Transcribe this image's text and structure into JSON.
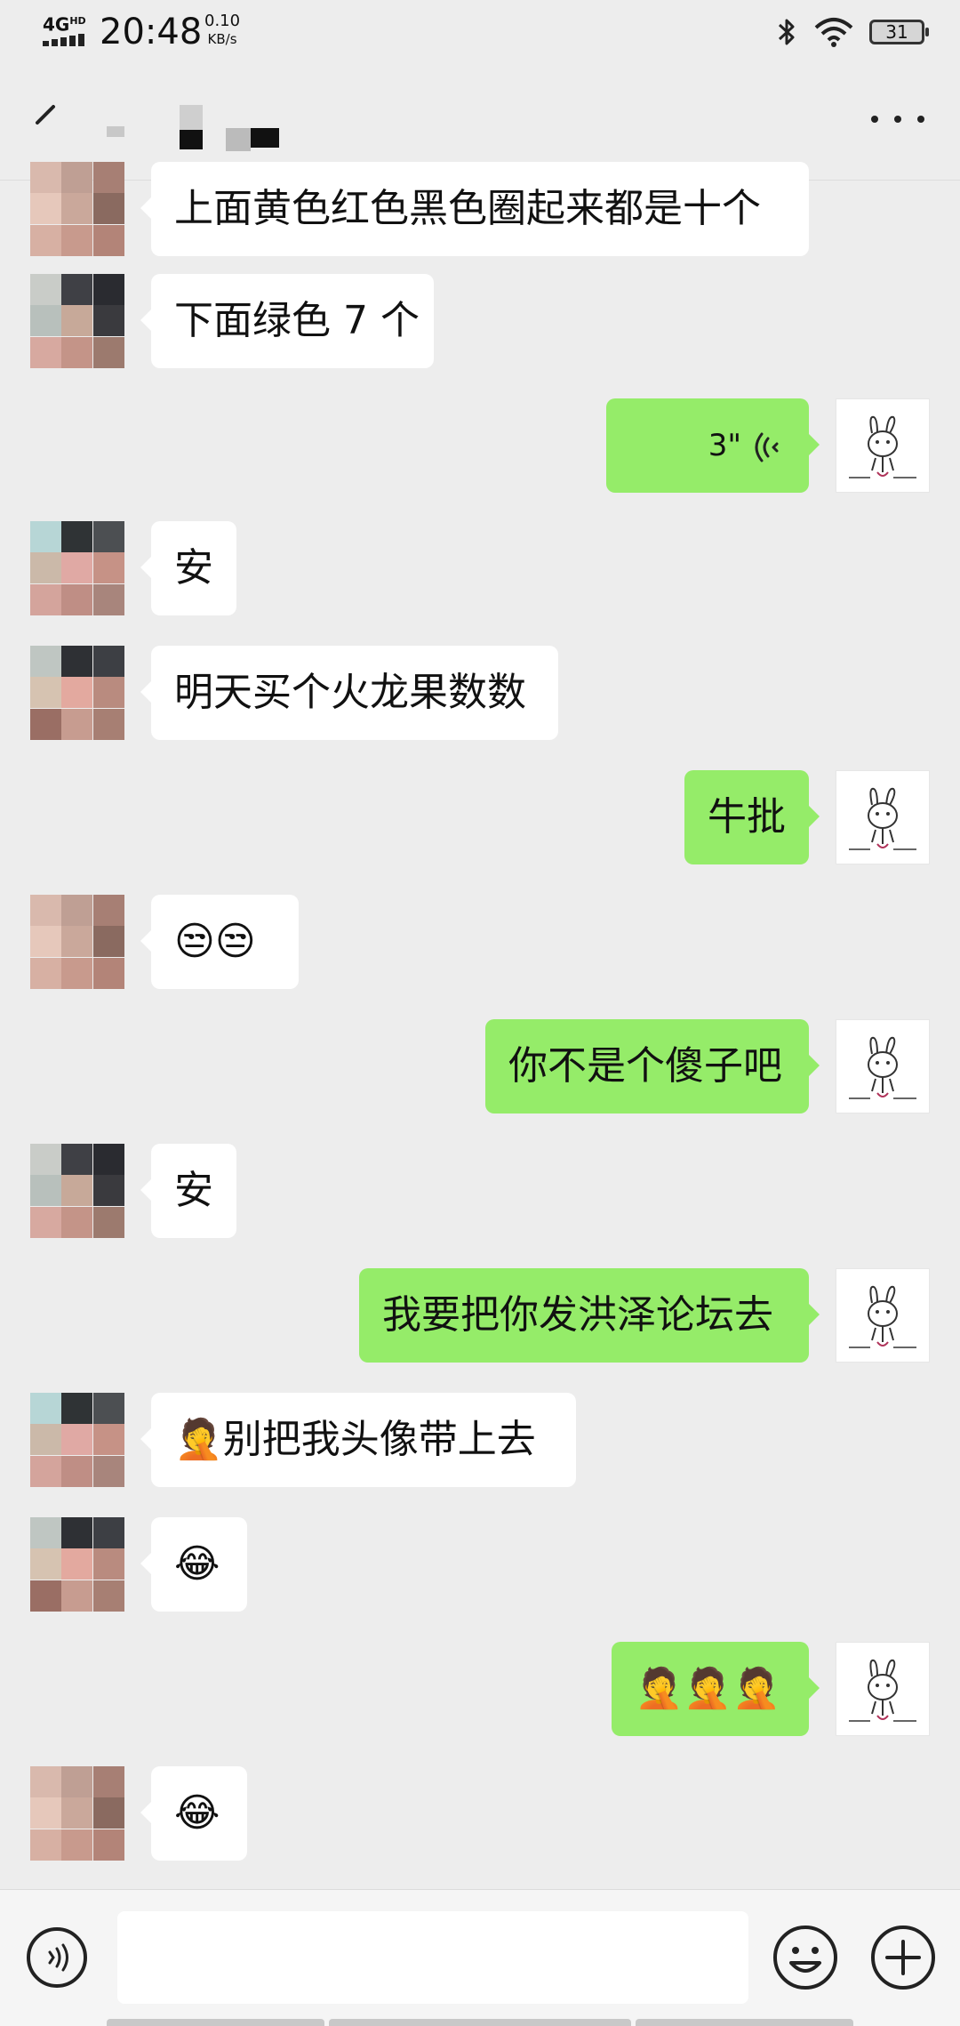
{
  "status_bar": {
    "network": "4G",
    "network_sup": "HD",
    "time": "20:48",
    "speed_value": "0.10",
    "speed_unit": "KB/s",
    "battery": "31"
  },
  "header": {
    "title": "",
    "more_icon": "ellipsis-icon",
    "back_icon": "back-arrow-icon"
  },
  "messages": [
    {
      "side": "left",
      "text": "上面黄色红色黑色圈起来都是十个"
    },
    {
      "side": "left",
      "text": "下面绿色 7 个"
    },
    {
      "side": "right",
      "type": "voice",
      "text": "3\""
    },
    {
      "side": "left",
      "text": "安"
    },
    {
      "side": "left",
      "text": "明天买个火龙果数数"
    },
    {
      "side": "right",
      "text": "牛批"
    },
    {
      "side": "left",
      "text": "😒😒"
    },
    {
      "side": "right",
      "text": "你不是个傻子吧"
    },
    {
      "side": "left",
      "text": "安"
    },
    {
      "side": "right",
      "text": "我要把你发洪泽论坛去"
    },
    {
      "side": "left",
      "text": "🤦别把我头像带上去"
    },
    {
      "side": "left",
      "text": "😂"
    },
    {
      "side": "right",
      "text": "🤦🤦🤦"
    },
    {
      "side": "left",
      "text": "😂"
    }
  ],
  "colors": {
    "background": "#ededed",
    "bubble_self": "#95ec69",
    "bubble_other": "#ffffff"
  },
  "input": {
    "placeholder": "",
    "voice_icon": "voice-input-icon",
    "emoji_icon": "emoji-icon",
    "plus_icon": "plus-icon"
  }
}
